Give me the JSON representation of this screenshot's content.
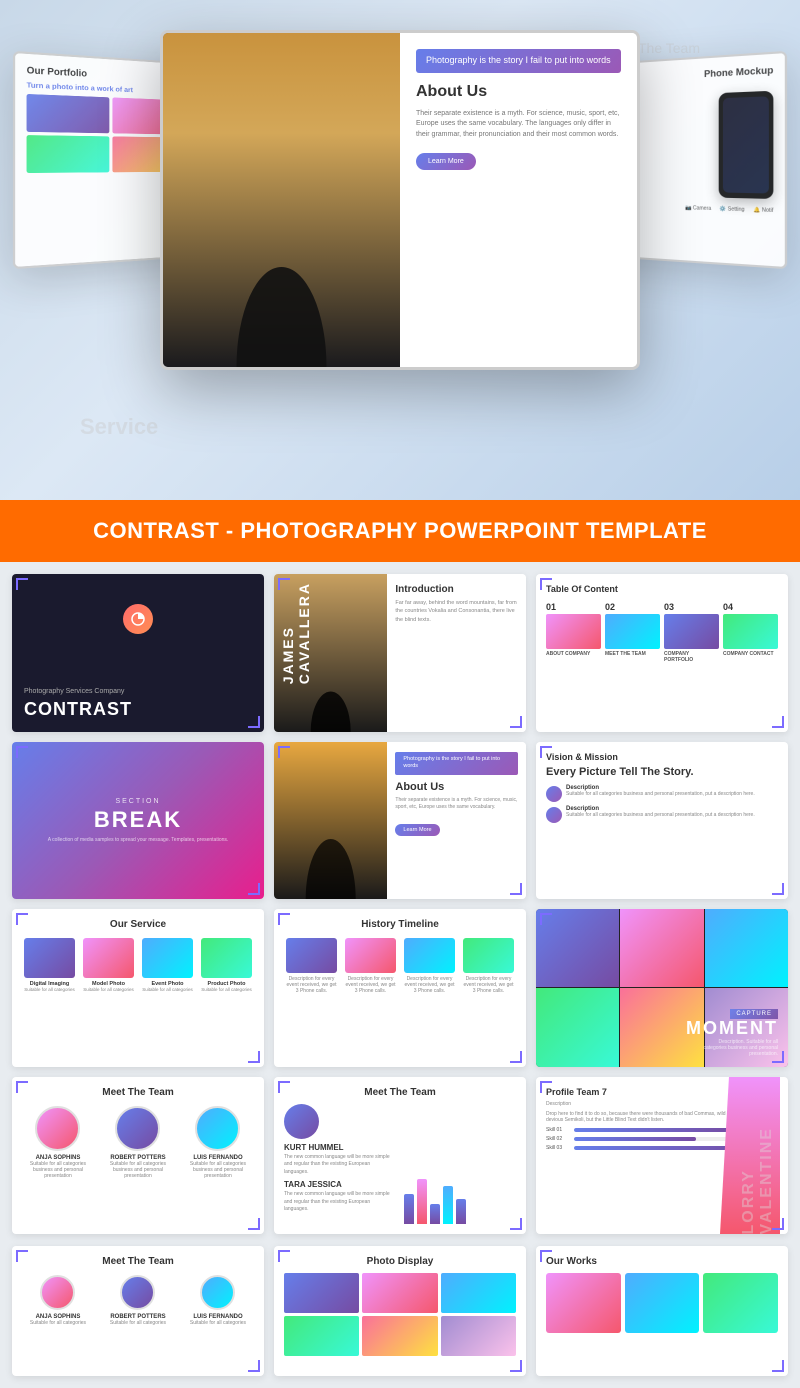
{
  "hero": {
    "monitor_left": {
      "title": "Our Portfolio",
      "subtitle": "Turn a photo into a work of art"
    },
    "monitor_main": {
      "tag": "Photography is the story\nI fail to put into words",
      "title": "About Us",
      "text": "Their separate existence is a myth. For science, music, sport, etc, Europe uses the same vocabulary. The languages only differ in their grammar, their pronunciation and their most common words.",
      "button": "Learn More"
    },
    "monitor_right": {
      "title": "Phone Mockup",
      "labels": [
        "Camera",
        "Setting",
        "Notification"
      ]
    }
  },
  "title_banner": {
    "text": "CONTRAST - PHOTOGRAPHY POWERPOINT TEMPLATE"
  },
  "slides": [
    {
      "id": "contrast",
      "label": "CONTRAST",
      "subtitle": "Photography Services Company"
    },
    {
      "id": "introduction",
      "label": "1 Introduction",
      "person": "JAMES CAVALLERA",
      "text": "Far far away, behind the word mountains, far from the countries Vokalia and Consonantia, there live the blind texts."
    },
    {
      "id": "table-of-content",
      "label": "Table Of Content",
      "items": [
        "01 ABOUT COMPANY",
        "02 MEET THE TEAM",
        "03",
        "04 COMPANY CONTACT"
      ]
    },
    {
      "id": "section-break",
      "label": "SECTION BREAK",
      "word": "BREAK",
      "text": "A collection of media samples to spread your message. Templates, presentations."
    },
    {
      "id": "about-us",
      "label": "About Us",
      "tag": "Photography is the story\nI fail to put into words",
      "text": "Their separate existence is a myth. For science, music, sport, etc, Europe uses the same vocabulary.",
      "button": "Learn More"
    },
    {
      "id": "vision-mission",
      "label": "Vision & Mission",
      "subtitle": "Every Picture Tell The Story.",
      "items": [
        {
          "title": "Description",
          "text": "Suitable for all categories business and personal presentation, put a description here."
        },
        {
          "title": "Description",
          "text": "Suitable for all categories business and personal presentation, put a description here."
        }
      ]
    },
    {
      "id": "our-service",
      "label": "Our Service",
      "items": [
        {
          "title": "Digital Imaging",
          "text": "Suitable for all categories"
        },
        {
          "title": "Model Photo",
          "text": "Suitable for all categories"
        },
        {
          "title": "Event Photo",
          "text": "Suitable for all categories"
        },
        {
          "title": "Product Photo",
          "text": "Suitable for all categories"
        }
      ]
    },
    {
      "id": "history-timeline",
      "label": "History Timeline",
      "items": [
        {
          "desc": "Description for every event received, we get 3 Phone calls."
        },
        {
          "desc": "Description for every event received, we get 3 Phone calls."
        },
        {
          "desc": "Description for every event received, we get 3 Phone calls."
        },
        {
          "desc": "Description for every event received, we get 3 Phone calls."
        }
      ]
    },
    {
      "id": "capture-moment",
      "label": "CAPTURE MOMENT",
      "text": "Description. Suitable for all categories business and personal presentation."
    },
    {
      "id": "meet-team-1",
      "label": "Meet The Team",
      "members": [
        {
          "name": "ANJA SOPHINS",
          "role": "Suitable for all categories business and personal presentation"
        },
        {
          "name": "ROBERT POTTERS",
          "role": "Suitable for all categories business and personal presentation"
        },
        {
          "name": "LUIS FERNANDO",
          "role": "Suitable for all categories business and personal presentation"
        }
      ]
    },
    {
      "id": "meet-team-2",
      "label": "Meet The Team",
      "person1": "KURT HUMMEL",
      "text1": "The new common language will be more simple and regular than the existing European languages.",
      "person2": "TARA JESSICA",
      "text2": "The new common language will be more simple and regular than the existing European languages."
    },
    {
      "id": "profile-team",
      "label": "Profile Team 7",
      "name": "LORRY VALENTINE",
      "description": "Description",
      "text": "Drop here to find it to do so, because there were thousands of bad Commas, wild Question Marks and devious Semikoli, but the Little Blind Text didn't listen.",
      "bars": [
        {
          "label": "Skill 01",
          "value": 80
        },
        {
          "label": "Skill 02",
          "value": 60
        },
        {
          "label": "Skill 03",
          "value": 90
        }
      ]
    }
  ],
  "bottom_slides": [
    {
      "id": "meet-team-bottom",
      "label": "Meet The Team"
    },
    {
      "id": "photo-display",
      "label": "Photo Display"
    },
    {
      "id": "our-works",
      "label": "Our Works"
    }
  ]
}
